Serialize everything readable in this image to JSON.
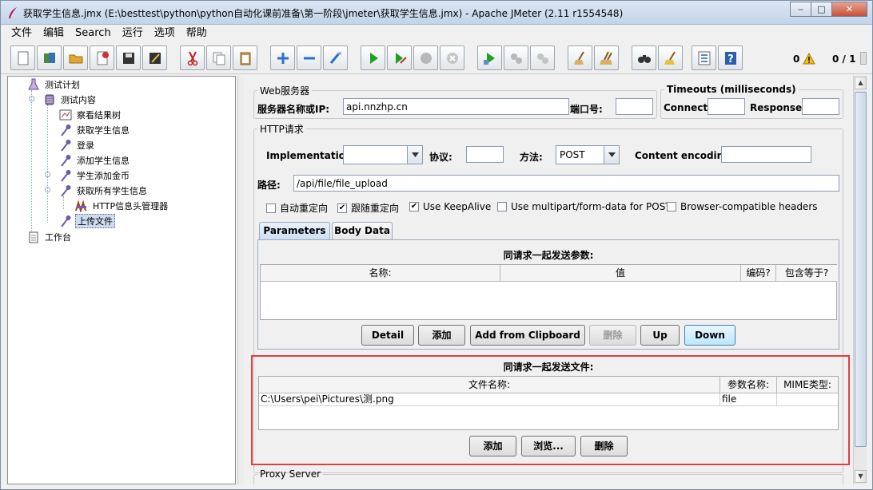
{
  "window": {
    "title": "获取学生信息.jmx (E:\\besttest\\python\\python自动化课前准备\\第一阶段\\jmeter\\获取学生信息.jmx) - Apache JMeter (2.11 r1554548)"
  },
  "menu": [
    "文件",
    "编辑",
    "Search",
    "运行",
    "选项",
    "帮助"
  ],
  "toolbar": {
    "warning_count": "0",
    "thread_count": "0 / 1"
  },
  "tree": {
    "items": [
      {
        "label": "测试计划",
        "icon": "test-plan-icon"
      },
      {
        "label": "测试内容",
        "icon": "thread-group-icon"
      },
      {
        "label": "察看结果树",
        "icon": "listener-icon"
      },
      {
        "label": "获取学生信息",
        "icon": "sampler-icon"
      },
      {
        "label": "登录",
        "icon": "sampler-icon"
      },
      {
        "label": "添加学生信息",
        "icon": "sampler-icon"
      },
      {
        "label": "学生添加金币",
        "icon": "sampler-icon"
      },
      {
        "label": "获取所有学生信息",
        "icon": "sampler-icon"
      },
      {
        "label": "HTTP信息头管理器",
        "icon": "header-manager-icon"
      },
      {
        "label": "上传文件",
        "icon": "sampler-icon"
      },
      {
        "label": "工作台",
        "icon": "workbench-icon"
      }
    ]
  },
  "web_server": {
    "legend": "Web服务器",
    "server_label": "服务器名称或IP:",
    "server_value": "api.nnzhp.cn",
    "port_label": "端口号:",
    "port_value": ""
  },
  "timeouts": {
    "legend": "Timeouts (milliseconds)",
    "connect_label": "Connect:",
    "connect_value": "",
    "response_label": "Response:",
    "response_value": ""
  },
  "http_request": {
    "legend": "HTTP请求",
    "implementation_label": "Implementation:",
    "implementation_value": "",
    "protocol_label": "协议:",
    "protocol_value": "",
    "method_label": "方法:",
    "method_value": "POST",
    "encoding_label": "Content encoding:",
    "encoding_value": "",
    "path_label": "路径:",
    "path_value": "/api/file/file_upload"
  },
  "checkboxes": [
    {
      "label": "自动重定向",
      "checked": false
    },
    {
      "label": "跟随重定向",
      "checked": true
    },
    {
      "label": "Use KeepAlive",
      "checked": true
    },
    {
      "label": "Use multipart/form-data for POST",
      "checked": false
    },
    {
      "label": "Browser-compatible headers",
      "checked": false
    }
  ],
  "tabs": {
    "parameters": "Parameters",
    "body_data": "Body Data"
  },
  "params": {
    "title": "同请求一起发送参数:",
    "columns": [
      "名称:",
      "值",
      "编码?",
      "包含等于?"
    ],
    "buttons": {
      "detail": "Detail",
      "add": "添加",
      "add_clipboard": "Add from Clipboard",
      "delete": "删除",
      "up": "Up",
      "down": "Down"
    }
  },
  "files": {
    "title": "同请求一起发送文件:",
    "columns": [
      "文件名称:",
      "参数名称:",
      "MIME类型:"
    ],
    "rows": [
      {
        "path": "C:\\Users\\pei\\Pictures\\测.png",
        "param": "file",
        "mime": ""
      }
    ],
    "buttons": {
      "add": "添加",
      "browse": "浏览...",
      "delete": "删除"
    }
  },
  "proxy": {
    "legend": "Proxy Server"
  }
}
